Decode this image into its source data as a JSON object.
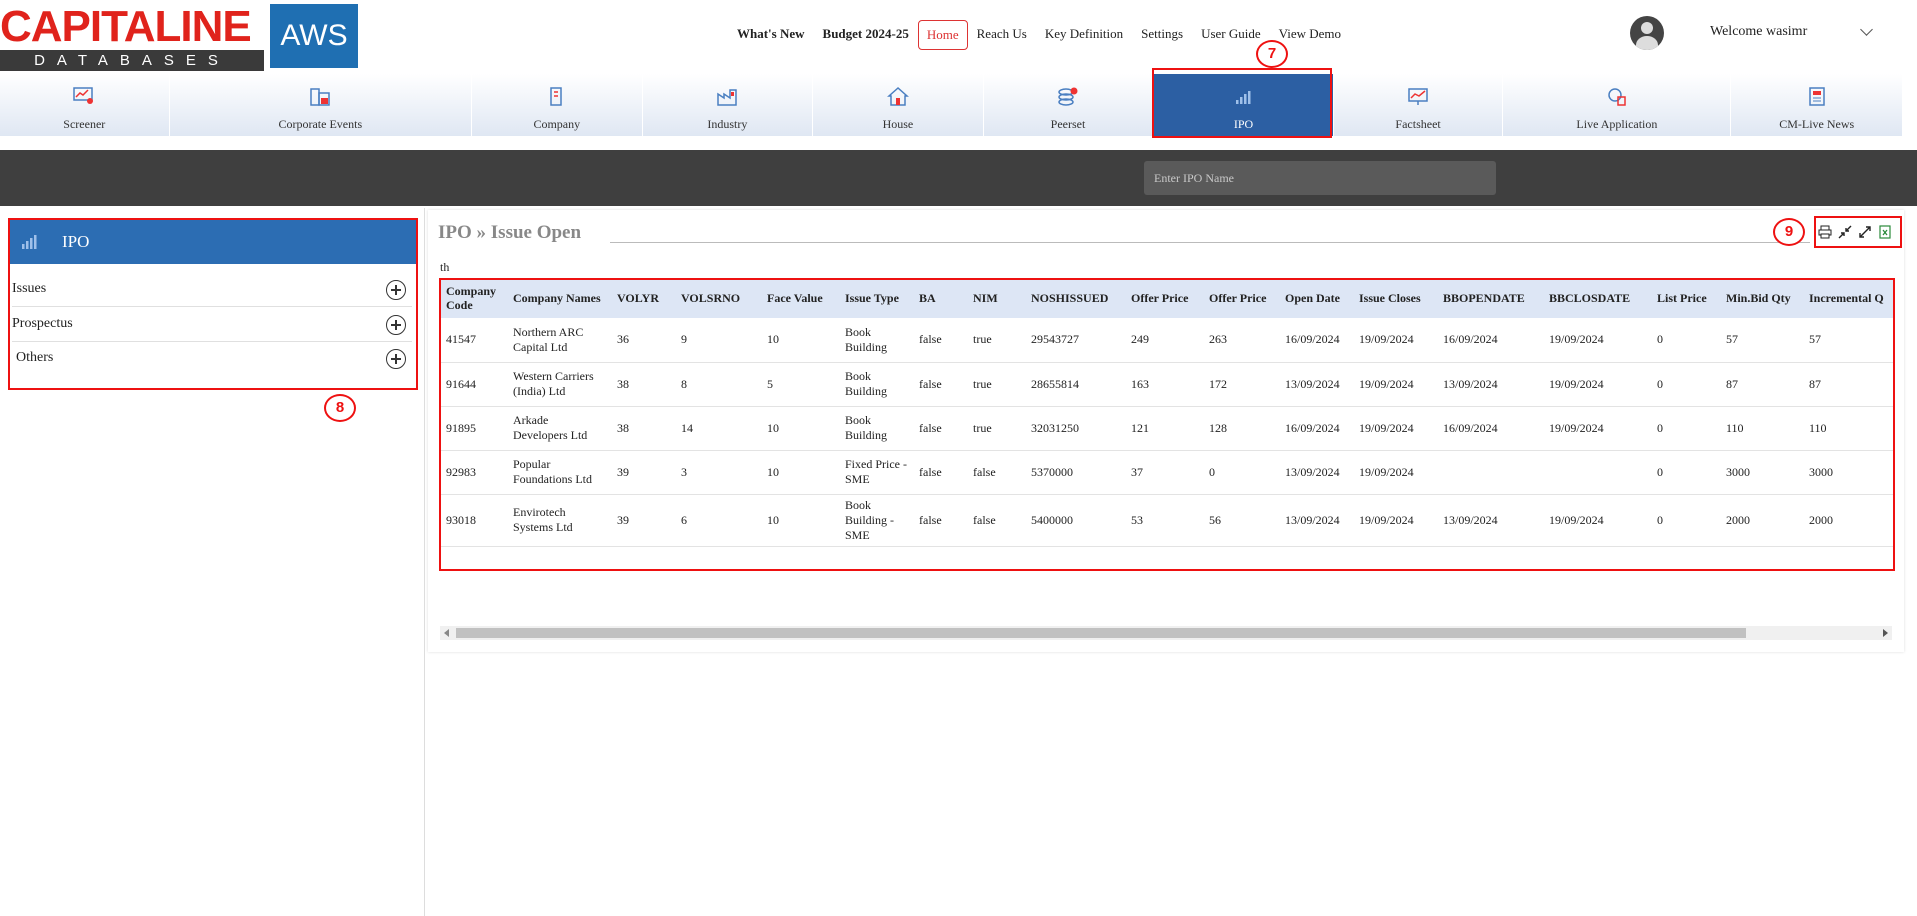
{
  "logo": {
    "capital": "CAPITALINE",
    "databases": "DATABASES",
    "aws": "AWS"
  },
  "topnav": [
    "What's New",
    "Budget 2024-25",
    "Home",
    "Reach Us",
    "Key Definition",
    "Settings",
    "User Guide",
    "View Demo"
  ],
  "user": {
    "welcome": "Welcome wasimr"
  },
  "modules": [
    "Screener",
    "Corporate Events",
    "Company",
    "Industry",
    "House",
    "Peerset",
    "IPO",
    "Factsheet",
    "Live Application",
    "CM-Live News"
  ],
  "active_module": "IPO",
  "search": {
    "placeholder": "Enter IPO Name"
  },
  "sidebar": {
    "title": "IPO",
    "items": [
      "Issues",
      "Prospectus",
      "Others"
    ]
  },
  "breadcrumb": {
    "root": "IPO",
    "sep": "»",
    "page": "Issue Open"
  },
  "th_text": "th",
  "annotations": {
    "b7": "7",
    "b8": "8",
    "b9": "9"
  },
  "table": {
    "headers": [
      "Company Code",
      "Company Names",
      "VOLYR",
      "VOLSRNO",
      "Face Value",
      "Issue Type",
      "BA",
      "NIM",
      "NOSHISSUED",
      "Offer Price",
      "Offer Price",
      "Open Date",
      "Issue Closes",
      "BBOPENDATE",
      "BBCLOSDATE",
      "List Price",
      "Min.Bid Qty",
      "Incremental Q"
    ],
    "rows": [
      [
        "41547",
        "Northern ARC Capital Ltd",
        "36",
        "9",
        "10",
        "Book Building",
        "false",
        "true",
        "29543727",
        "249",
        "263",
        "16/09/2024",
        "19/09/2024",
        "16/09/2024",
        "19/09/2024",
        "0",
        "57",
        "57"
      ],
      [
        "91644",
        "Western Carriers (India) Ltd",
        "38",
        "8",
        "5",
        "Book Building",
        "false",
        "true",
        "28655814",
        "163",
        "172",
        "13/09/2024",
        "19/09/2024",
        "13/09/2024",
        "19/09/2024",
        "0",
        "87",
        "87"
      ],
      [
        "91895",
        "Arkade Developers Ltd",
        "38",
        "14",
        "10",
        "Book Building",
        "false",
        "true",
        "32031250",
        "121",
        "128",
        "16/09/2024",
        "19/09/2024",
        "16/09/2024",
        "19/09/2024",
        "0",
        "110",
        "110"
      ],
      [
        "92983",
        "Popular Foundations Ltd",
        "39",
        "3",
        "10",
        "Fixed Price - SME",
        "false",
        "false",
        "5370000",
        "37",
        "0",
        "13/09/2024",
        "19/09/2024",
        "",
        "",
        "0",
        "3000",
        "3000"
      ],
      [
        "93018",
        "Envirotech Systems Ltd",
        "39",
        "6",
        "10",
        "Book Building - SME",
        "false",
        "false",
        "5400000",
        "53",
        "56",
        "13/09/2024",
        "19/09/2024",
        "13/09/2024",
        "19/09/2024",
        "0",
        "2000",
        "2000"
      ]
    ]
  }
}
